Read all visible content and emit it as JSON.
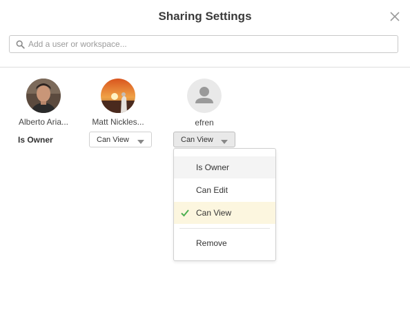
{
  "dialog": {
    "title": "Sharing Settings",
    "close_icon": "close-icon"
  },
  "search": {
    "placeholder": "Add a user or workspace...",
    "value": "",
    "icon": "search-icon"
  },
  "users": [
    {
      "name": "Alberto Aria...",
      "role": "Is Owner",
      "role_editable": false,
      "avatar": "photo-avatar-man"
    },
    {
      "name": "Matt Nickles...",
      "role": "Can View",
      "role_editable": true,
      "avatar": "photo-avatar-sunset"
    },
    {
      "name": "efren",
      "role": "Can View",
      "role_editable": true,
      "avatar": "default-person-icon"
    }
  ],
  "permission_menu": {
    "open_for": "efren",
    "options": [
      {
        "label": "Is Owner"
      },
      {
        "label": "Can Edit"
      },
      {
        "label": "Can View",
        "selected": true
      },
      {
        "label": "Remove"
      }
    ],
    "check_icon": "checkmark-icon"
  },
  "colors": {
    "check_green": "#4cb050",
    "selected_bg": "#fcf6df",
    "hover_bg": "#f4f4f4"
  }
}
